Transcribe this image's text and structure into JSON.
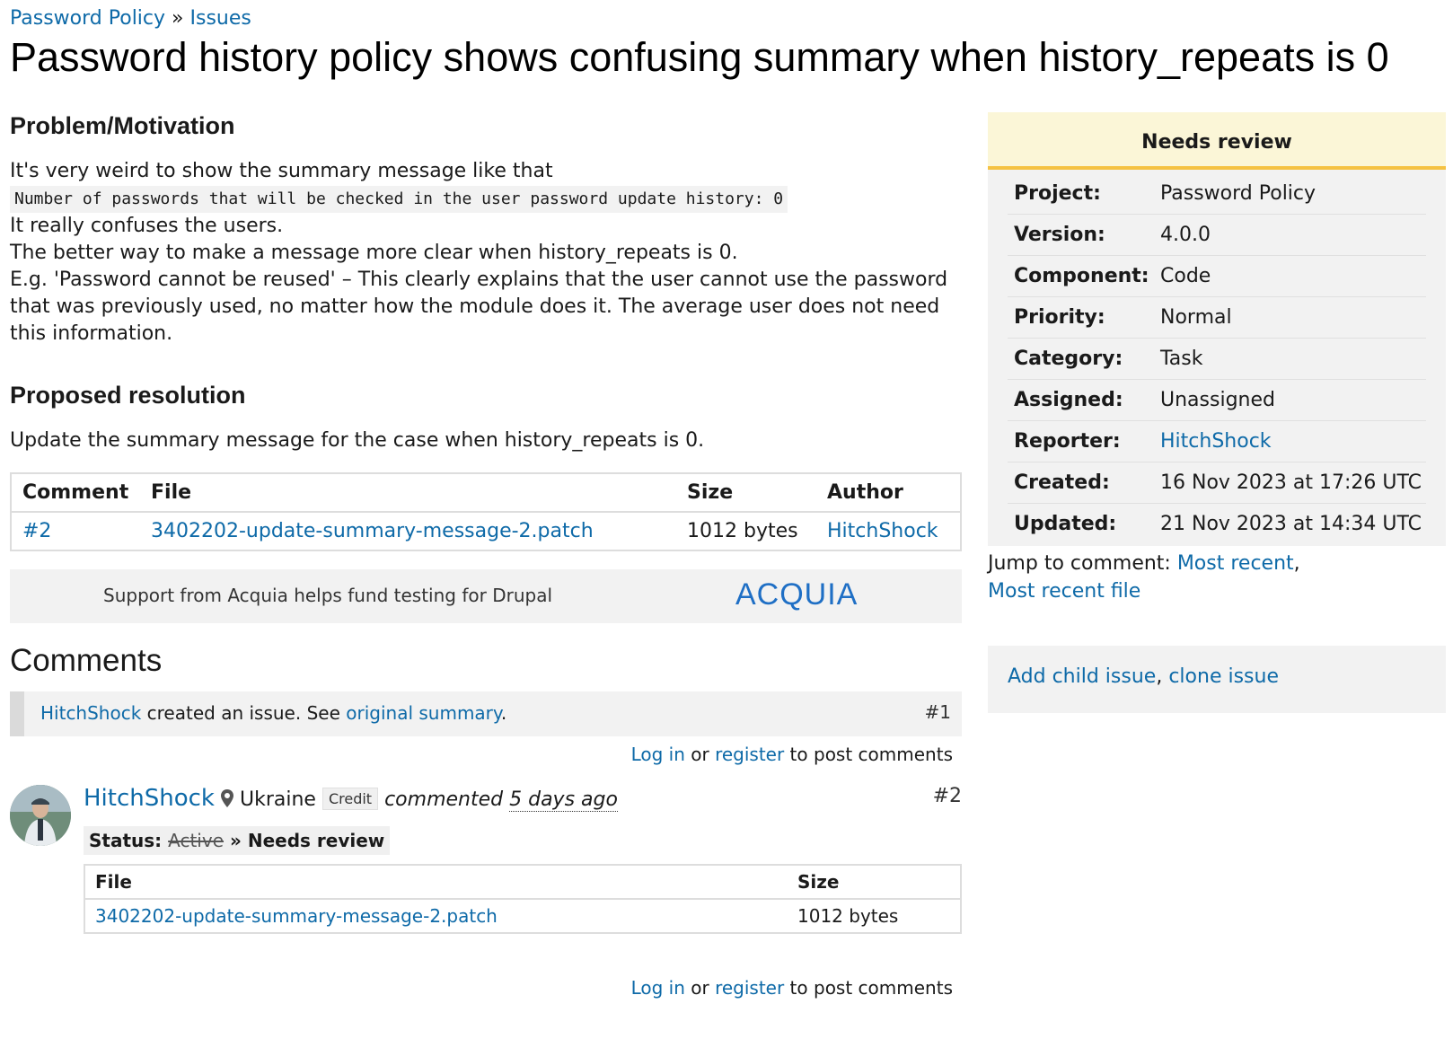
{
  "breadcrumb": {
    "project": "Password Policy",
    "separator": "»",
    "issues": "Issues"
  },
  "title": "Password history policy shows confusing summary when history_repeats is 0",
  "problem": {
    "heading": "Problem/Motivation",
    "line1": "It's very weird to show the summary message like that",
    "code": "Number of passwords that will be checked in the user password update history: 0",
    "line2": "It really confuses the users.",
    "line3": "The better way to make a message more clear when history_repeats is 0.",
    "line4": "E.g. 'Password cannot be reused' – This clearly explains that the user cannot use the password that was previously used, no matter how the module does it. The average user does not need this information."
  },
  "resolution": {
    "heading": "Proposed resolution",
    "text": "Update the summary message for the case when history_repeats is 0."
  },
  "files_table": {
    "headers": [
      "Comment",
      "File",
      "Size",
      "Author"
    ],
    "rows": [
      {
        "comment": "#2",
        "file": "3402202-update-summary-message-2.patch",
        "size": "1012 bytes",
        "author": "HitchShock"
      }
    ]
  },
  "acquia": {
    "text": "Support from Acquia helps fund testing for Drupal",
    "logo": "ACQUIA"
  },
  "comments": {
    "heading": "Comments",
    "system": {
      "user": "HitchShock",
      "mid": " created an issue. See ",
      "link": "original summary",
      "end": ".",
      "number": "#1"
    },
    "login": {
      "log_in": "Log in",
      "or": " or ",
      "register": "register",
      "tail": " to post comments"
    },
    "comment2": {
      "user": "HitchShock",
      "location": "Ukraine",
      "credit": "Credit",
      "commented": "commented",
      "ago": "5 days ago",
      "number": "#2",
      "status_label": "Status:",
      "status_old": "Active",
      "status_sep": "»",
      "status_new": "Needs review",
      "file_headers": [
        "File",
        "Size"
      ],
      "file_name": "3402202-update-summary-message-2.patch",
      "file_size": "1012 bytes"
    }
  },
  "sidebar": {
    "status": "Needs review",
    "meta": [
      {
        "key": "Project:",
        "value": "Password Policy"
      },
      {
        "key": "Version:",
        "value": "4.0.0"
      },
      {
        "key": "Component:",
        "value": "Code"
      },
      {
        "key": "Priority:",
        "value": "Normal"
      },
      {
        "key": "Category:",
        "value": "Task"
      },
      {
        "key": "Assigned:",
        "value": "Unassigned"
      },
      {
        "key": "Reporter:",
        "value": "HitchShock"
      },
      {
        "key": "Created:",
        "value": "16 Nov 2023 at 17:26 UTC"
      },
      {
        "key": "Updated:",
        "value": "21 Nov 2023 at 14:34 UTC"
      }
    ],
    "jump_label": "Jump to comment: ",
    "jump_recent": "Most recent",
    "jump_comma": ",",
    "jump_recent_file": "Most recent file",
    "add_child": "Add child issue",
    "child_comma": ", ",
    "clone": "clone issue"
  },
  "colors": {
    "link": "#0e6aa8",
    "status_bg": "#fbf6d7",
    "status_border": "#f5c242",
    "panel_bg": "#f2f2f2"
  }
}
